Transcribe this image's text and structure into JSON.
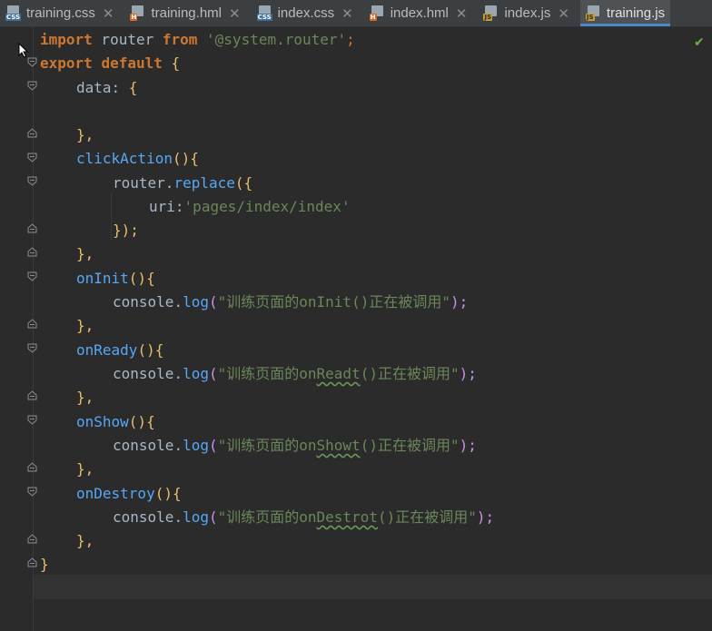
{
  "tabs": [
    {
      "name": "training.css",
      "type": "CSS",
      "active": false
    },
    {
      "name": "training.hml",
      "type": "H",
      "active": false
    },
    {
      "name": "index.css",
      "type": "CSS",
      "active": false
    },
    {
      "name": "index.hml",
      "type": "H",
      "active": false
    },
    {
      "name": "index.js",
      "type": "JS",
      "active": false
    },
    {
      "name": "training.js",
      "type": "JS",
      "active": true
    }
  ],
  "close_glyph": "✕",
  "status": {
    "check_icon": "check-icon",
    "color": "#62b543"
  },
  "code": {
    "l1_kw1": "import",
    "l1_mid": " router ",
    "l1_kw2": "from",
    "l1_str": "'@system.router'",
    "l1_end": ";",
    "l2_kw1": "export",
    "l2_kw2": "default",
    "l2_brace": "{",
    "l3_key": "data",
    "l3_colon": ": ",
    "l3_brace": "{",
    "l5": "},",
    "l6_fn": "clickAction",
    "l6_paren": "()",
    "l6_brace": "{",
    "l7_obj": "router",
    "l7_dot": ".",
    "l7_fn": "replace",
    "l7_open": "({",
    "l8_key": "uri",
    "l8_colon": ":",
    "l8_str": "'pages/index/index'",
    "l9": "});",
    "l10": "},",
    "l11_fn": "onInit",
    "l11_paren": "()",
    "l11_brace": "{",
    "l12_obj": "console",
    "l12_fn": "log",
    "l12_str_a": "\"训练页面的",
    "l12_str_b": "onInit()",
    "l12_str_c": "正在被调用\"",
    "l12_end": ");",
    "l13": "},",
    "l14_fn": "onReady",
    "l14_paren": "()",
    "l14_brace": "{",
    "l15_obj": "console",
    "l15_fn": "log",
    "l15_str_a": "\"训练页面的on",
    "l15_str_b": "Readt",
    "l15_str_c": "()正在被调用\"",
    "l15_end": ");",
    "l16": "},",
    "l17_fn": "onShow",
    "l17_paren": "()",
    "l17_brace": "{",
    "l18_obj": "console",
    "l18_fn": "log",
    "l18_str_a": "\"训练页面的on",
    "l18_str_b": "Showt",
    "l18_str_c": "()正在被调用\"",
    "l18_end": ");",
    "l19": "},",
    "l20_fn": "onDestroy",
    "l20_paren": "()",
    "l20_brace": "{",
    "l21_obj": "console",
    "l21_fn": "log",
    "l21_str_a": "\"训练页面的on",
    "l21_str_b": "Destrot",
    "l21_str_c": "()正在被调用\"",
    "l21_end": ");",
    "l22": "},",
    "l23": "}"
  }
}
